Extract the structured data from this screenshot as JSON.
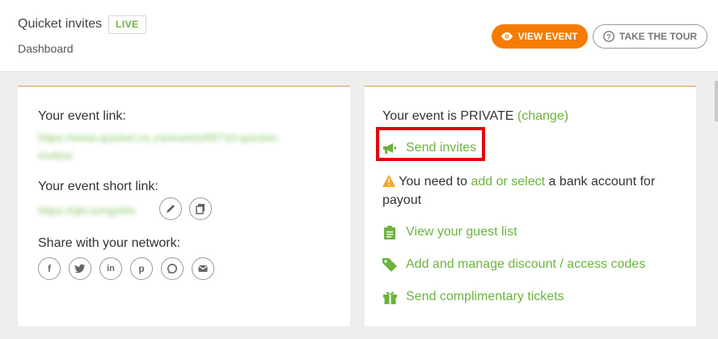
{
  "header": {
    "app_title": "Quicket invites",
    "status_badge": "LIVE",
    "subtitle": "Dashboard",
    "view_event_label": "VIEW EVENT",
    "tour_label": "TAKE THE TOUR"
  },
  "left_card": {
    "event_link_label": "Your event link:",
    "event_link_value_line1": "https://www.quicket.co.za/events/89710-quicket-",
    "event_link_value_line2": "invites/",
    "short_link_label": "Your event short link:",
    "short_link_value": "https://qkt.io/ngxf4s",
    "share_label": "Share with your network:",
    "social_icons": [
      "facebook-icon",
      "twitter-icon",
      "linkedin-icon",
      "pinterest-icon",
      "whatsapp-icon",
      "email-icon"
    ]
  },
  "right_card": {
    "privacy_text": "Your event is PRIVATE",
    "change_link": "(change)",
    "send_invites": "Send invites",
    "bank_prefix": "You need to",
    "bank_link": "add or select",
    "bank_suffix": "a bank account for",
    "bank_line2": "payout",
    "guest_list": "View your guest list",
    "discount_codes": "Add and manage discount / access codes",
    "complimentary": "Send complimentary tickets"
  },
  "colors": {
    "accent_orange": "#f57c00",
    "link_green": "#6db33f",
    "highlight_red": "#e3000f",
    "warning": "#f5a623"
  }
}
